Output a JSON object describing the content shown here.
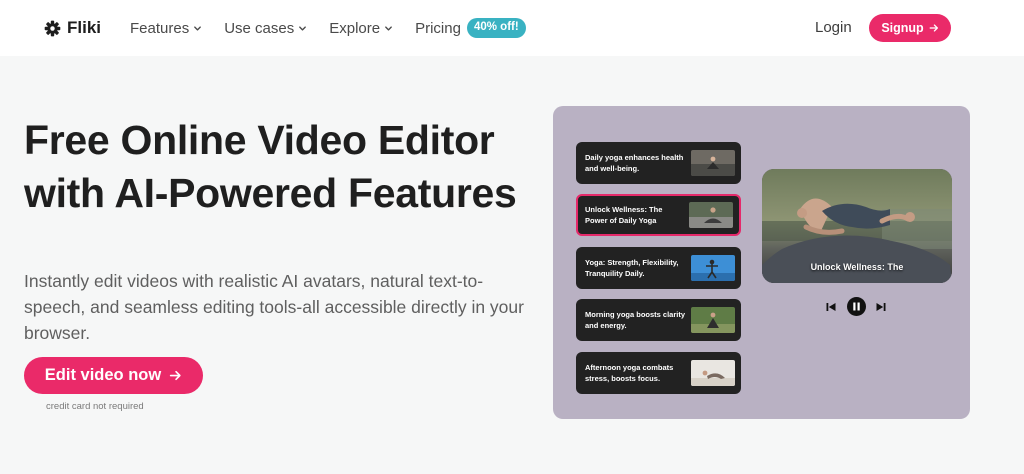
{
  "brand": {
    "name": "Fliki"
  },
  "nav": {
    "items": [
      {
        "label": "Features"
      },
      {
        "label": "Use cases"
      },
      {
        "label": "Explore"
      }
    ],
    "pricing_label": "Pricing",
    "pricing_badge": "40% off!",
    "login_label": "Login",
    "signup_label": "Signup"
  },
  "hero": {
    "title": "Free Online Video Editor with AI-Powered Features",
    "subtitle": "Instantly edit videos with realistic AI avatars, natural text-to-speech, and seamless editing tools-all accessible directly in your browser.",
    "cta_label": "Edit video now",
    "cta_note": "credit card not required"
  },
  "editor": {
    "scenes": [
      {
        "text": "Daily yoga enhances health and well-being."
      },
      {
        "text": "Unlock Wellness: The Power of Daily Yoga",
        "active": true
      },
      {
        "text": "Yoga: Strength, Flexibility, Tranquility Daily."
      },
      {
        "text": "Morning yoga boosts clarity and energy."
      },
      {
        "text": "Afternoon yoga combats stress, boosts focus."
      }
    ],
    "video_caption": "Unlock Wellness: The"
  },
  "colors": {
    "accent": "#ea2a69",
    "badge": "#39b2c2",
    "panel": "#b9b1c3",
    "scene_bg": "#222222"
  },
  "icons": {
    "brand": "gear-logo-icon",
    "dropdown": "chevron-down-icon",
    "arrow": "arrow-right-icon",
    "prev": "skip-previous-icon",
    "pause": "pause-icon",
    "next": "skip-next-icon"
  }
}
